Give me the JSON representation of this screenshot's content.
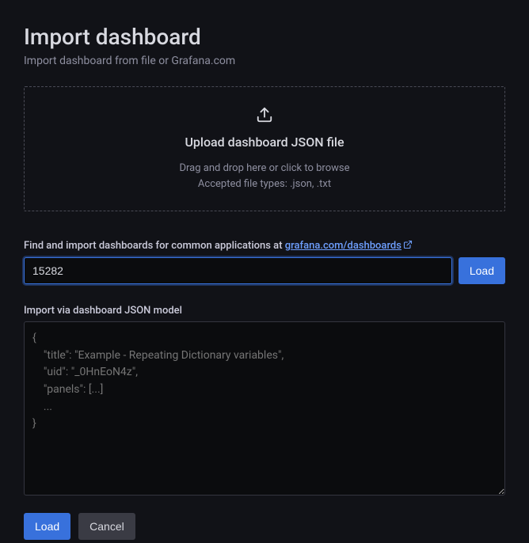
{
  "header": {
    "title": "Import dashboard",
    "subtitle": "Import dashboard from file or Grafana.com"
  },
  "upload": {
    "title": "Upload dashboard JSON file",
    "hint_line1": "Drag and drop here or click to browse",
    "hint_line2": "Accepted file types: .json, .txt"
  },
  "url_section": {
    "label_prefix": "Find and import dashboards for common applications at ",
    "link_text": "grafana.com/dashboards",
    "input_value": "15282",
    "load_button": "Load"
  },
  "json_section": {
    "label": "Import via dashboard JSON model",
    "placeholder": "{\n    \"title\": \"Example - Repeating Dictionary variables\",\n    \"uid\": \"_0HnEoN4z\",\n    \"panels\": [...]\n    ...\n}"
  },
  "footer": {
    "load_button": "Load",
    "cancel_button": "Cancel"
  }
}
